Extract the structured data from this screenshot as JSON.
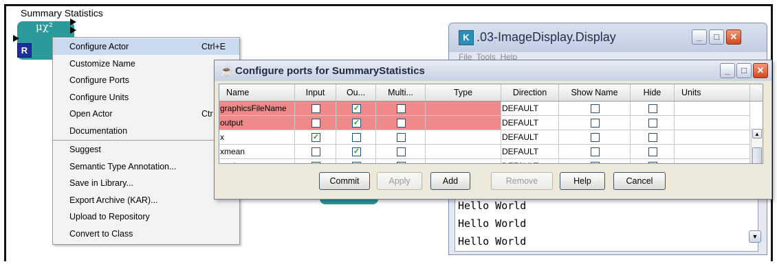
{
  "workflow": {
    "actor_name": "Summary Statistics",
    "actor_glyph": "μχ²",
    "badge": "R"
  },
  "context_menu": {
    "groups": [
      [
        {
          "label": "Configure Actor",
          "shortcut": "Ctrl+E"
        },
        {
          "label": "Customize Name",
          "shortcut": ""
        },
        {
          "label": "Configure Ports",
          "shortcut": ""
        },
        {
          "label": "Configure Units",
          "shortcut": ""
        },
        {
          "label": "Open Actor",
          "shortcut": "Ctr"
        },
        {
          "label": "Documentation",
          "shortcut": ""
        }
      ],
      [
        {
          "label": "Suggest",
          "shortcut": ""
        },
        {
          "label": "Semantic Type Annotation...",
          "shortcut": ""
        },
        {
          "label": "Save in Library...",
          "shortcut": ""
        },
        {
          "label": "Export Archive (KAR)...",
          "shortcut": ""
        },
        {
          "label": "Upload to Repository",
          "shortcut": ""
        },
        {
          "label": "Convert to Class",
          "shortcut": ""
        }
      ]
    ],
    "highlighted": "Configure Actor"
  },
  "display_window": {
    "icon_letter": "K",
    "title": ".03-ImageDisplay.Display",
    "hidden_menu_text": "File  Tools  Help",
    "output_lines": [
      "Hello World",
      "Hello World",
      "Hello World"
    ]
  },
  "port_dialog": {
    "title": "Configure ports for SummaryStatistics",
    "columns": [
      "Name",
      "Input",
      "Ou...",
      "Multi...",
      "Type",
      "Direction",
      "Show Name",
      "Hide",
      "Units"
    ],
    "rows": [
      {
        "name": "graphicsFileName",
        "input": false,
        "output": true,
        "multi": false,
        "type": "",
        "direction": "DEFAULT",
        "show_name": false,
        "hide": false,
        "units": "",
        "highlight": true
      },
      {
        "name": "output",
        "input": false,
        "output": true,
        "multi": false,
        "type": "",
        "direction": "DEFAULT",
        "show_name": false,
        "hide": false,
        "units": "",
        "highlight": true
      },
      {
        "name": "x",
        "input": true,
        "output": false,
        "multi": false,
        "type": "",
        "direction": "DEFAULT",
        "show_name": false,
        "hide": false,
        "units": "",
        "highlight": false
      },
      {
        "name": "xmean",
        "input": false,
        "output": true,
        "multi": false,
        "type": "",
        "direction": "DEFAULT",
        "show_name": false,
        "hide": false,
        "units": "",
        "highlight": false
      },
      {
        "name": "xstd",
        "input": false,
        "output": true,
        "multi": false,
        "type": "",
        "direction": "DEFAULT",
        "show_name": false,
        "hide": false,
        "units": "",
        "highlight": false
      }
    ],
    "buttons": [
      {
        "label": "Commit",
        "enabled": true
      },
      {
        "label": "Apply",
        "enabled": false
      },
      {
        "label": "Add",
        "enabled": true
      },
      {
        "label": "Remove",
        "enabled": false
      },
      {
        "label": "Help",
        "enabled": true
      },
      {
        "label": "Cancel",
        "enabled": true
      }
    ]
  },
  "colors": {
    "actor_teal": "#2a9a9a",
    "row_highlight": "#f08a8a",
    "menu_highlight": "#c9d9ee",
    "check_green": "#21a121"
  }
}
